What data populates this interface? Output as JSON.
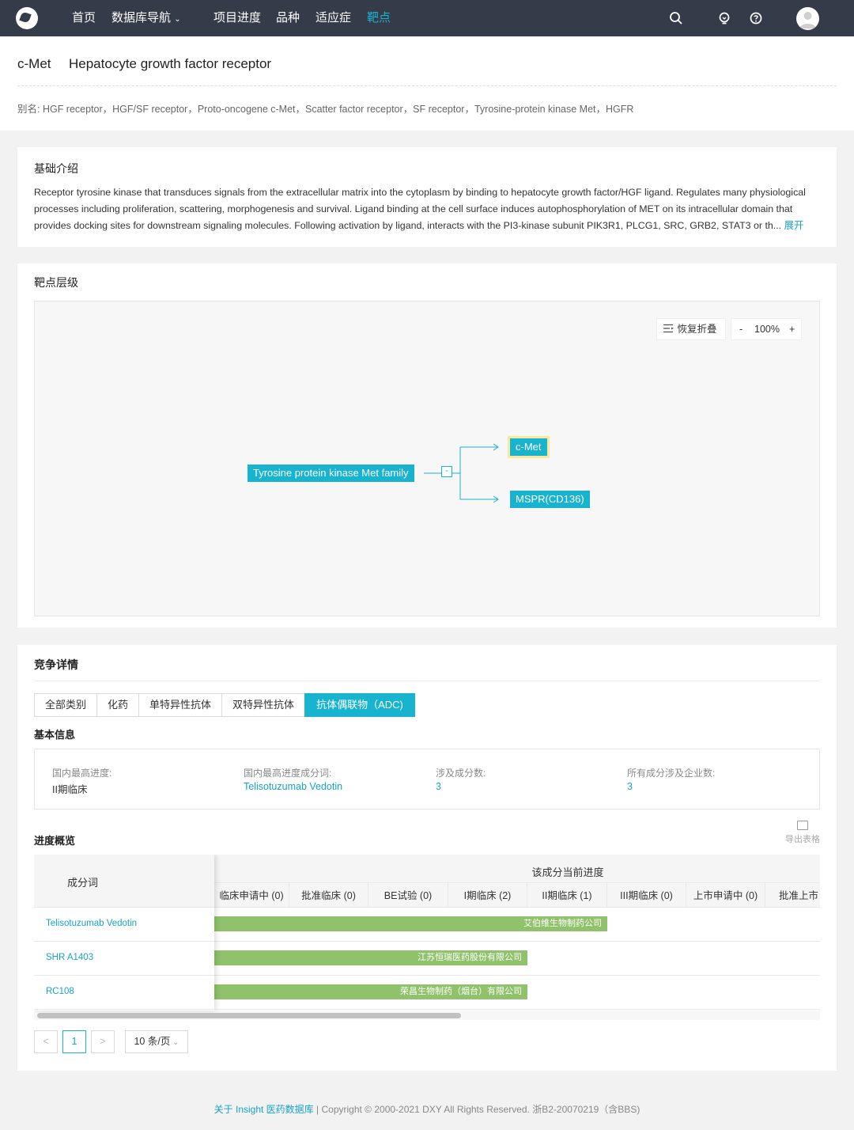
{
  "nav": {
    "items": [
      "首页",
      "数据库导航",
      "项目进度",
      "品种",
      "适应症",
      "靶点"
    ],
    "active": "靶点",
    "icons": [
      "search-icon",
      "bulb-icon",
      "help-icon",
      "user-avatar"
    ]
  },
  "target": {
    "abbr": "c-Met",
    "full_name": "Hepatocyte growth factor receptor",
    "aliases": "别名: HGF receptor，HGF/SF receptor，Proto-oncogene c-Met，Scatter factor receptor，SF receptor，Tyrosine-protein kinase Met，HGFR"
  },
  "intro": {
    "title": "基础介绍",
    "text": "Receptor tyrosine kinase that transduces signals from the extracellular matrix into the cytoplasm by binding to hepatocyte growth factor/HGF ligand. Regulates many physiological processes including proliferation, scattering, morphogenesis and survival. Ligand binding at the cell surface induces autophosphorylation of MET on its intracellular domain that provides docking sites for downstream signaling molecules. Following activation by ligand, interacts with the PI3-kinase subunit PIK3R1, PLCG1, SRC, GRB2, STAT3 or th...",
    "expand": "展开"
  },
  "hierarchy": {
    "title": "靶点层级",
    "restore": "恢复折叠",
    "zoom_minus": "-",
    "zoom": "100%",
    "zoom_plus": "+",
    "root": "Tyrosine protein kinase Met family",
    "collapse": "-",
    "children": [
      "c-Met",
      "MSPR(CD136)"
    ]
  },
  "competition": {
    "title": "竞争详情",
    "tabs": [
      "全部类别",
      "化药",
      "单特异性抗体",
      "双特异性抗体",
      "抗体偶联物（ADC)"
    ],
    "active_tab": "抗体偶联物（ADC)",
    "basic_title": "基本信息",
    "basic": [
      {
        "label": "国内最高进度:",
        "value": "II期临床"
      },
      {
        "label": "国内最高进度成分词:",
        "value": "Telisotuzumab Vedotin"
      },
      {
        "label": "涉及成分数:",
        "value": "3"
      },
      {
        "label": "所有成分涉及企业数:",
        "value": "3"
      }
    ],
    "progress_title": "进度概览",
    "export": "导出表格",
    "table": {
      "col_name": "成分词",
      "group": "该成分当前进度",
      "stages": [
        "临床申请中 (0)",
        "批准临床 (0)",
        "BE试验 (0)",
        "I期临床 (2)",
        "II期临床 (1)",
        "III期临床 (0)",
        "上市申请中 (0)",
        "批准上市"
      ],
      "rows": [
        {
          "name": "Telisotuzumab Vedotin",
          "company": "艾伯维生物制药公司",
          "stage_reached": "II期临床"
        },
        {
          "name": "SHR A1403",
          "company": "江苏恒瑞医药股份有限公司",
          "stage_reached": "I期临床"
        },
        {
          "name": "RC108",
          "company": "荣昌生物制药（烟台）有限公司",
          "stage_reached": "I期临床"
        }
      ],
      "bar_color": "#8fc26a"
    },
    "pagination": {
      "prev": "<",
      "page": "1",
      "next": ">",
      "size": "10 条/页"
    }
  },
  "footer": {
    "about": "关于 Insight 医药数据库",
    "copyright": "|  Copyright © 2000-2021 DXY All Rights Reserved. 浙B2-20070219（含BBS)"
  },
  "colors": {
    "nav_bg": "#363b49",
    "accent": "#17b3cf",
    "link": "#17a3c7"
  }
}
